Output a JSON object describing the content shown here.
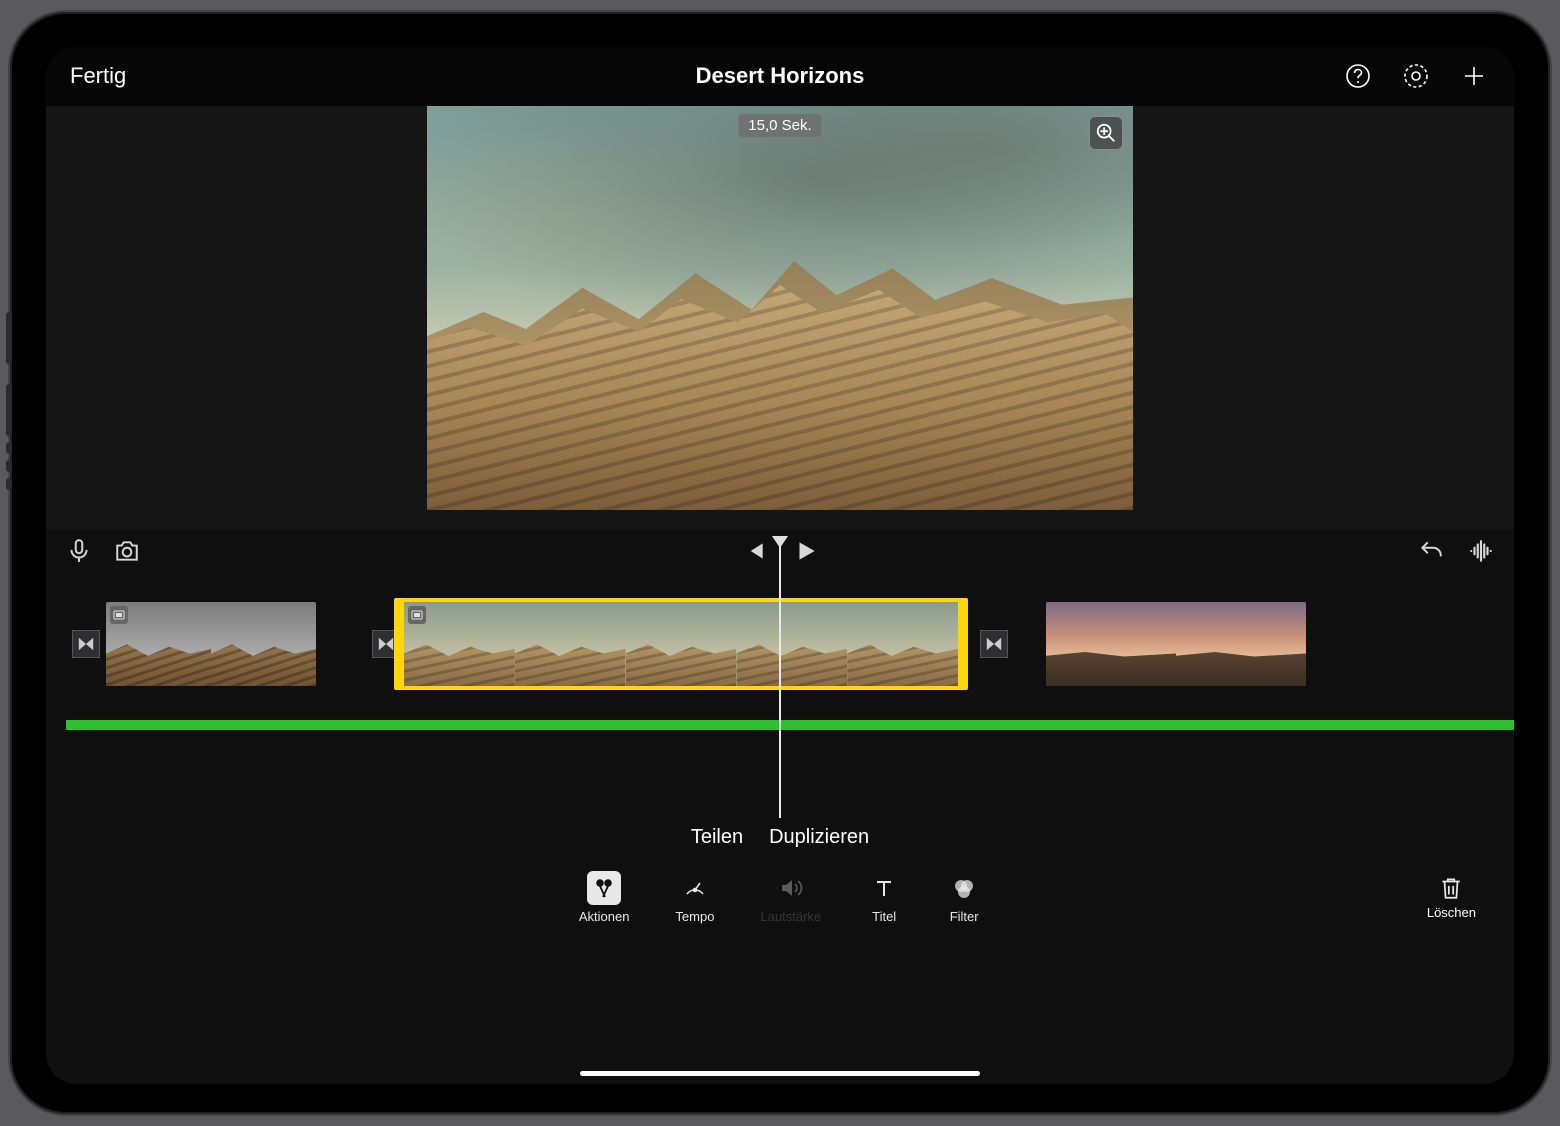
{
  "header": {
    "done_label": "Fertig",
    "title": "Desert Horizons"
  },
  "preview": {
    "duration_badge": "15,0 Sek."
  },
  "context_actions": {
    "split": "Teilen",
    "duplicate": "Duplizieren"
  },
  "tools": {
    "actions": "Aktionen",
    "speed": "Tempo",
    "volume": "Lautstärke",
    "titles": "Titel",
    "filters": "Filter",
    "delete": "Löschen"
  },
  "colors": {
    "selection": "#ffd60a",
    "audio_track": "#2fbf32"
  }
}
